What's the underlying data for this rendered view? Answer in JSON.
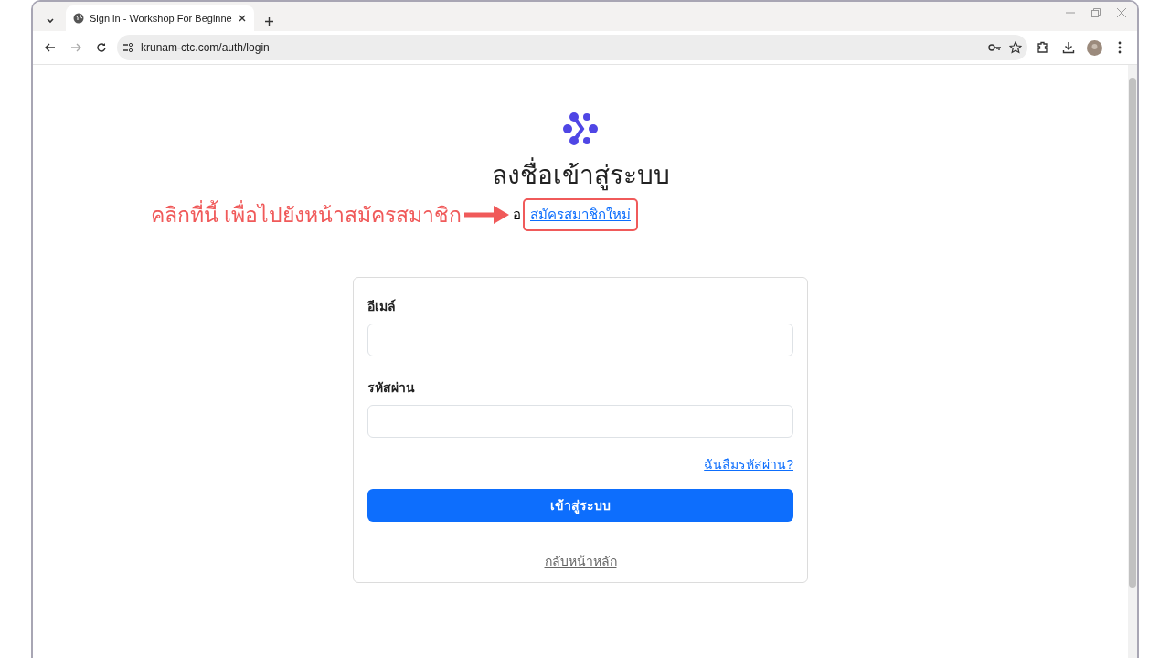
{
  "browser": {
    "tab_title": "Sign in - Workshop For Beginne",
    "url": "krunam-ctc.com/auth/login"
  },
  "page": {
    "heading": "ลงชื่อเข้าสู่ระบบ",
    "register_prefix": "อ",
    "register_link": "สมัครสมาชิกใหม่",
    "form": {
      "fields": [
        {
          "label": "อีเมล์"
        },
        {
          "label": "รหัสผ่าน"
        }
      ],
      "forgot_link": "ฉันลืมรหัสผ่าน?",
      "submit": "เข้าสู่ระบบ",
      "back_link": "กลับหน้าหลัก"
    }
  },
  "annotation": {
    "text": "คลิกที่นี้ เพื่อไปยังหน้าสมัครสมาชิก",
    "color": "#f05a5a"
  }
}
